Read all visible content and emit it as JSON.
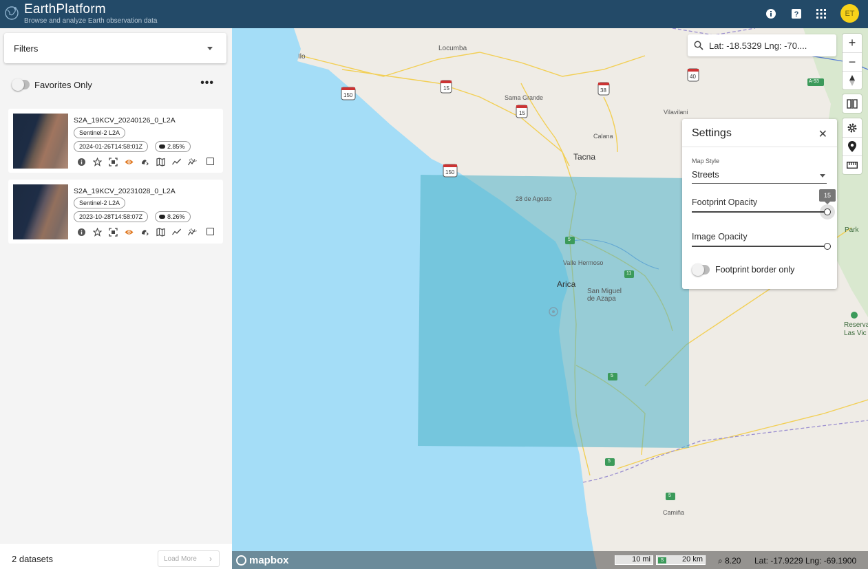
{
  "header": {
    "title": "EarthPlatform",
    "subtitle": "Browse and analyze Earth observation data",
    "avatar_initials": "ET",
    "icons": [
      "info-icon",
      "help-icon",
      "apps-grid-icon"
    ]
  },
  "sidebar": {
    "filters_label": "Filters",
    "favorites_label": "Favorites Only",
    "favorites_on": false,
    "items": [
      {
        "name": "S2A_19KCV_20240126_0_L2A",
        "collection": "Sentinel-2 L2A",
        "datetime": "2024-01-26T14:58:01Z",
        "cloud": "2.85%"
      },
      {
        "name": "S2A_19KCV_20231028_0_L2A",
        "collection": "Sentinel-2 L2A",
        "datetime": "2023-10-28T14:58:07Z",
        "cloud": "8.26%"
      }
    ],
    "dataset_count": "2 datasets",
    "load_more_label": "Load More"
  },
  "map": {
    "search_value": "Lat: -18.5329 Lng: -70....",
    "places": {
      "ilo": "Ilo",
      "locumba": "Locumba",
      "sama_grande": "Sama Grande",
      "vilavilani": "Vilavilani",
      "calana": "Calana",
      "tacna": "Tacna",
      "agosto": "28 de Agosto",
      "valle_hermoso": "Valle Hermoso",
      "arica": "Arica",
      "san_miguel": "San Miguel\nde Azapa",
      "reserva": "Reserva N\nLas Vic",
      "park": "Park",
      "camina": "Camiña"
    },
    "shields": {
      "r150a": "150",
      "r15a": "15",
      "r15b": "15",
      "r38": "38",
      "r40": "40",
      "r150b": "150",
      "a93": "A-93",
      "r5a": "5",
      "r11": "11",
      "r5b": "5",
      "r5c": "5",
      "r5d": "5"
    },
    "settings": {
      "title": "Settings",
      "map_style_label": "Map Style",
      "map_style_value": "Streets",
      "footprint_opacity_label": "Footprint Opacity",
      "footprint_opacity_value": "15",
      "footprint_opacity_fraction": 1.0,
      "image_opacity_label": "Image Opacity",
      "image_opacity_fraction": 1.0,
      "footprint_border_label": "Footprint border only",
      "footprint_border_on": false
    },
    "attribution": {
      "logo": "mapbox",
      "scale_mi": "10 mi",
      "scale_km": "20 km",
      "scale_marker": "S",
      "zoom": "8.20",
      "coords": "Lat: -17.9229  Lng: -69.1900"
    },
    "colors": {
      "water": "#a4ddf7",
      "footprint": "#4fb3c9",
      "land": "#efece6",
      "header": "#234a68"
    }
  }
}
